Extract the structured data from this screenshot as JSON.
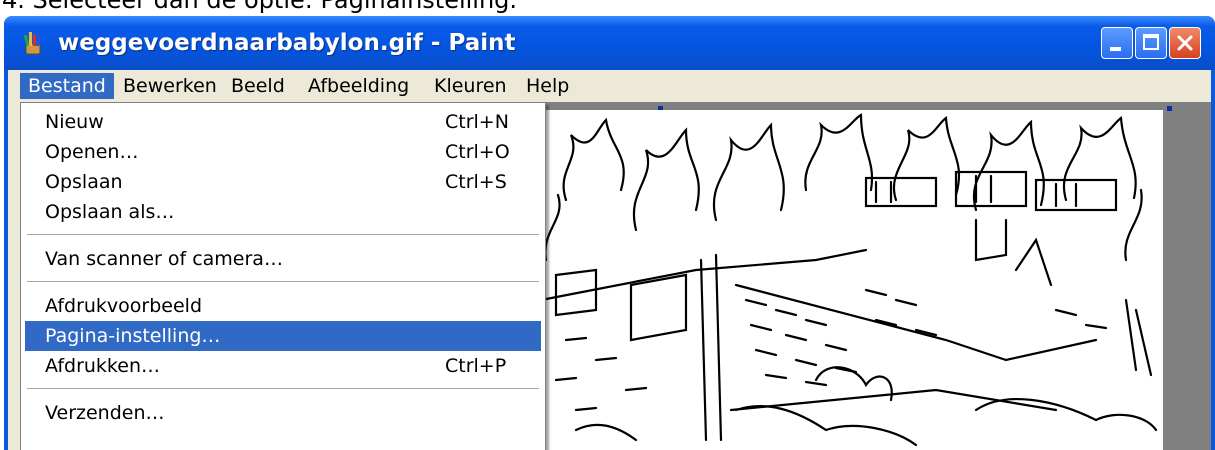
{
  "caption": "4. Selecteer dan de optie: Paginainstelling.",
  "window": {
    "title": "weggevoerdnaarbabylon.gif - Paint",
    "app_icon": "paint-icon",
    "buttons": {
      "minimize": "minimize-icon",
      "maximize": "maximize-icon",
      "close": "close-icon"
    }
  },
  "menubar": {
    "items": [
      "Bestand",
      "Bewerken",
      "Beeld",
      "Afbeelding",
      "Kleuren",
      "Help"
    ],
    "active": "Bestand"
  },
  "file_menu": {
    "items": [
      {
        "label": "Nieuw",
        "shortcut": "Ctrl+N"
      },
      {
        "label": "Openen…",
        "shortcut": "Ctrl+O"
      },
      {
        "label": "Opslaan",
        "shortcut": "Ctrl+S"
      },
      {
        "label": "Opslaan als…",
        "shortcut": ""
      },
      {
        "label": "Van scanner of camera…",
        "shortcut": ""
      },
      {
        "label": "Afdrukvoorbeeld",
        "shortcut": ""
      },
      {
        "label": "Pagina-instelling…",
        "shortcut": ""
      },
      {
        "label": "Afdrukken…",
        "shortcut": "Ctrl+P"
      },
      {
        "label": "Verzenden…",
        "shortcut": ""
      }
    ],
    "highlighted": "Pagina-instelling…"
  },
  "canvas": {
    "image_description_icon": "line-drawing-image"
  },
  "colors": {
    "titlebar": "#0454e0",
    "menu_highlight": "#316ac5",
    "face": "#ece9d8",
    "workspace": "#808080"
  }
}
